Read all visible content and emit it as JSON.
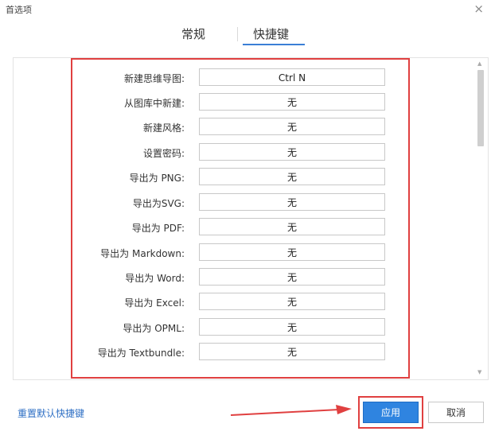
{
  "window": {
    "title": "首选项",
    "close_symbol": "×"
  },
  "tabs": [
    {
      "label": "常规",
      "active": false
    },
    {
      "label": "快捷键",
      "active": true
    }
  ],
  "shortcuts": [
    {
      "label": "新建思维导图:",
      "value": "Ctrl N"
    },
    {
      "label": "从图库中新建:",
      "value": "无"
    },
    {
      "label": "新建风格:",
      "value": "无"
    },
    {
      "label": "设置密码:",
      "value": "无"
    },
    {
      "label": "导出为 PNG:",
      "value": "无"
    },
    {
      "label": "导出为SVG:",
      "value": "无"
    },
    {
      "label": "导出为 PDF:",
      "value": "无"
    },
    {
      "label": "导出为 Markdown:",
      "value": "无"
    },
    {
      "label": "导出为 Word:",
      "value": "无"
    },
    {
      "label": "导出为 Excel:",
      "value": "无"
    },
    {
      "label": "导出为 OPML:",
      "value": "无"
    },
    {
      "label": "导出为 Textbundle:",
      "value": "无"
    }
  ],
  "footer": {
    "reset_label": "重置默认快捷键",
    "apply_label": "应用",
    "cancel_label": "取消"
  },
  "colors": {
    "accent": "#2f84e0",
    "annotation": "#e04040",
    "link": "#2e6fc4"
  }
}
